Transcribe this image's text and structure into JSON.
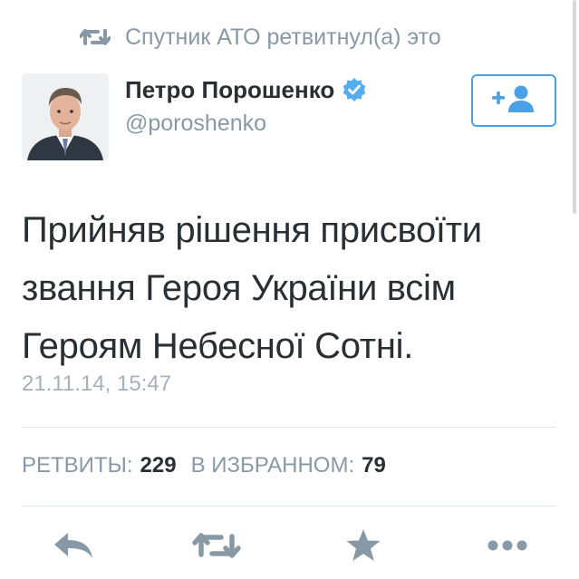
{
  "retweet_context": {
    "text": "Спутник АТО ретвитнул(а) это",
    "icon": "retweet-icon"
  },
  "author": {
    "name": "Петро Порошенко",
    "handle": "@poroshenko",
    "verified": true,
    "avatar": "avatar-photo"
  },
  "follow_button": {
    "icon": "follow-user-icon"
  },
  "tweet": {
    "lines": [
      "Прийняв рішення присвоїти",
      "звання Героя України всім",
      "Героям Небесної Сотні."
    ],
    "timestamp": "21.11.14, 15:47"
  },
  "stats": {
    "retweets_label": "РЕТВИТЫ:",
    "retweets_count": "229",
    "favorites_label": "В ИЗБРАННОМ:",
    "favorites_count": "79"
  },
  "actions": [
    "reply-icon",
    "retweet-icon",
    "favorite-star-icon",
    "more-icon"
  ],
  "colors": {
    "muted": "#8899a6",
    "accent": "#4aa1e8",
    "text": "#292f33",
    "divider": "#e1e8ed"
  }
}
